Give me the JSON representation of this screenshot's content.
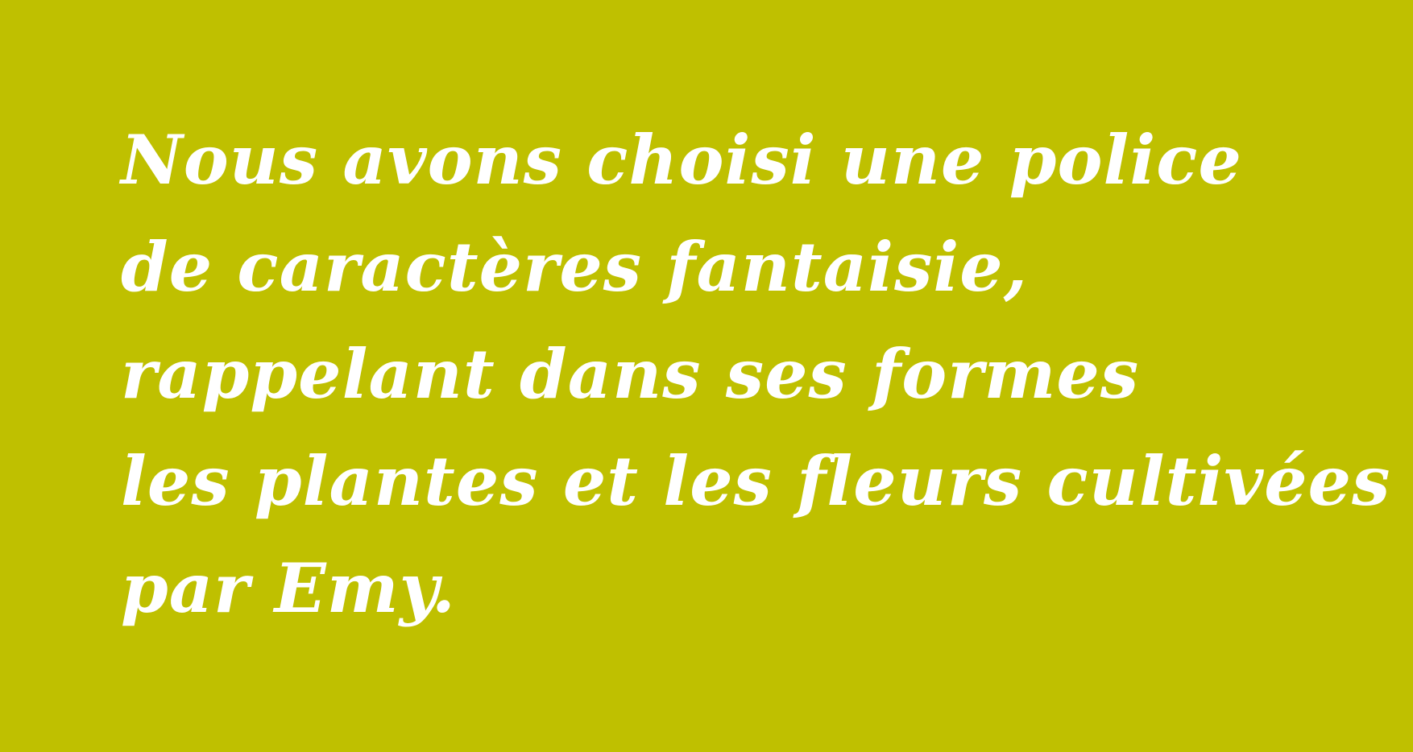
{
  "background_color": "#bfc000",
  "text_color": "#ffffff",
  "quote": {
    "lines": [
      "Nous avons choisi une police",
      "de caractères fantaisie,",
      "rappelant dans ses formes",
      "les plantes et les fleurs cultivées",
      "par Emy."
    ]
  }
}
